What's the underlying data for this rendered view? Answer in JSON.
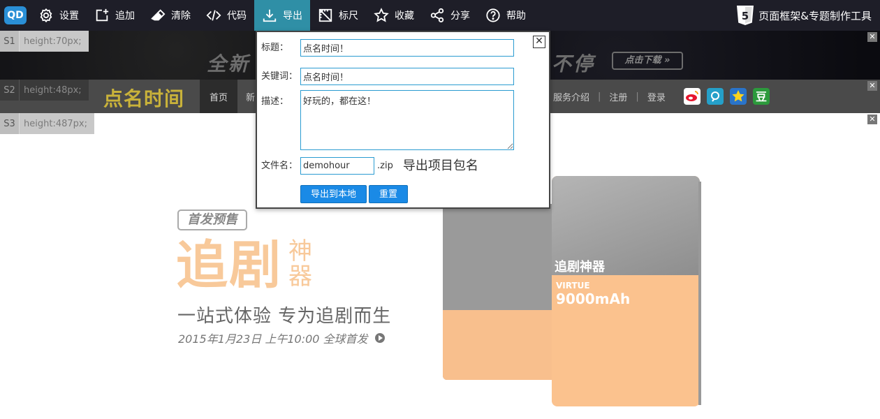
{
  "toolbar": {
    "logo": "QD",
    "items": [
      {
        "label": "设置",
        "icon": "gear-icon"
      },
      {
        "label": "追加",
        "icon": "add-square-icon"
      },
      {
        "label": "清除",
        "icon": "eraser-icon"
      },
      {
        "label": "代码",
        "icon": "code-icon"
      },
      {
        "label": "导出",
        "icon": "download-icon",
        "active": true
      },
      {
        "label": "标尺",
        "icon": "ruler-icon"
      },
      {
        "label": "收藏",
        "icon": "star-icon"
      },
      {
        "label": "分享",
        "icon": "share-icon"
      },
      {
        "label": "帮助",
        "icon": "help-icon"
      }
    ],
    "app_title": "页面框架&专题制作工具"
  },
  "sections": [
    {
      "id": "S1",
      "height": "height:70px;"
    },
    {
      "id": "S2",
      "height": "height:48px;"
    },
    {
      "id": "S3",
      "height": "height:487px;"
    }
  ],
  "s1": {
    "banner_left": "全新",
    "banner_right": "不停",
    "download": "点击下载 »"
  },
  "s2": {
    "brand": "点名时间",
    "nav_home": "首页",
    "nav_partial": "新",
    "right_links": [
      "服务介绍",
      "注册",
      "登录"
    ],
    "separator": "|",
    "social": [
      "weibo-icon",
      "tencent-weibo-icon",
      "qzone-icon",
      "douban-icon"
    ],
    "douban_glyph": "豆"
  },
  "s3": {
    "presale": "首发预售",
    "title_main": "追剧",
    "title_side": "神器",
    "slogan": "一站式体验  专为追剧而生",
    "date": "2015年1月23日  上午10:00  全球首发",
    "device_mark": "追剧神器",
    "device_model": "VIRTUE",
    "device_capacity": "9000mAh"
  },
  "dialog": {
    "title_label": "标题：",
    "title_value": "点名时间！",
    "keywords_label": "关键词：",
    "keywords_value": "点名时间！",
    "desc_label": "描述：",
    "desc_value": "好玩的，都在这！",
    "filename_label": "文件名：",
    "filename_value": "demohour",
    "filename_ext": ".zip",
    "filename_hint": "导出项目包名",
    "export_button": "导出到本地",
    "reset_button": "重置",
    "close": "✕"
  },
  "colors": {
    "accent": "#2f8fa6",
    "button": "#1a8ae6",
    "brand": "#c9b23a",
    "peach": "#f8c99a"
  }
}
